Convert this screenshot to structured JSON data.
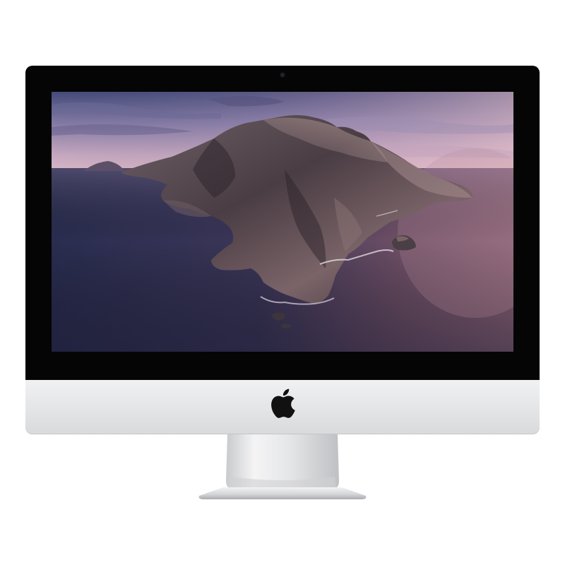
{
  "device": {
    "type": "all-in-one desktop computer",
    "colors": {
      "bezel": "#050505",
      "chin": "#e5e6e8",
      "logo": "#111111",
      "stand": "#d8d9db"
    }
  },
  "screen": {
    "wallpaper": "island-at-dusk",
    "colors": {
      "sky_top": "#3f4470",
      "sky_mid": "#8b7ea4",
      "sky_horizon": "#d9b7c4",
      "sea_left": "#2c2f52",
      "sea_right": "#8b6478",
      "island_dark": "#3a3138",
      "island_light": "#8a7570"
    }
  },
  "icons": {
    "logo": "apple-logo-icon",
    "camera": "camera-icon"
  }
}
